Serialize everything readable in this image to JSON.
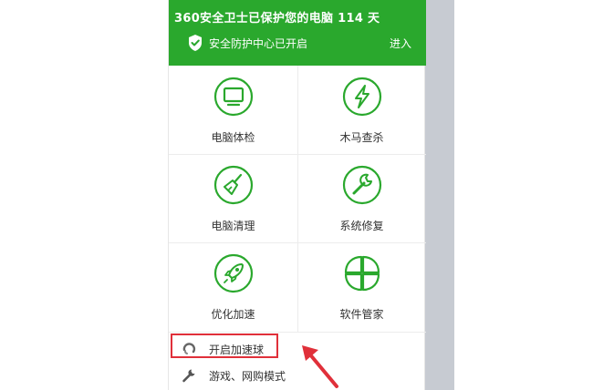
{
  "header": {
    "title": "360安全卫士已保护您的电脑 114 天",
    "status": "安全防护中心已开启",
    "enter_label": "进入"
  },
  "tiles": [
    {
      "label": "电脑体检",
      "icon": "monitor-icon"
    },
    {
      "label": "木马查杀",
      "icon": "lightning-icon"
    },
    {
      "label": "电脑清理",
      "icon": "broom-icon"
    },
    {
      "label": "系统修复",
      "icon": "wrench-icon"
    },
    {
      "label": "优化加速",
      "icon": "rocket-icon"
    },
    {
      "label": "软件管家",
      "icon": "clover-icon"
    }
  ],
  "menu": {
    "items": [
      {
        "label": "开启加速球",
        "icon": "speed-ball-icon"
      },
      {
        "label": "游戏、网购模式",
        "icon": "wrench-icon"
      }
    ]
  },
  "colors": {
    "brand_green": "#2aa82d",
    "annotation_red": "#e0303a"
  }
}
